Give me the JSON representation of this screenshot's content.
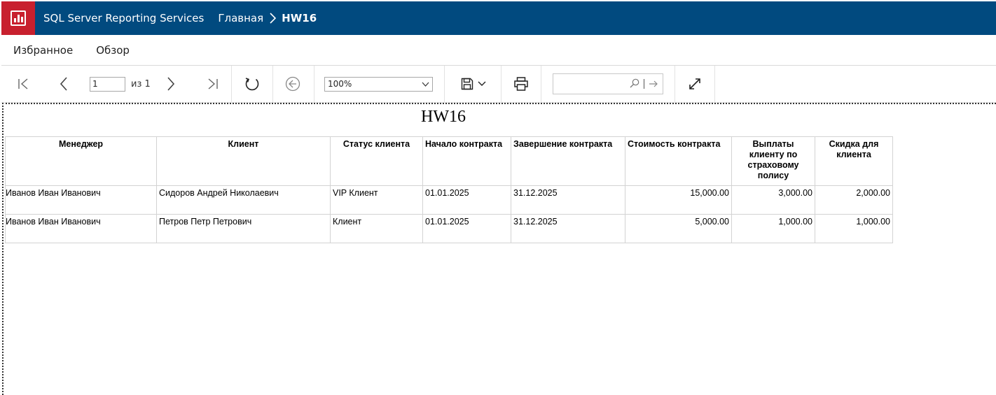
{
  "app": {
    "title": "SQL Server Reporting Services",
    "breadcrumb": {
      "home": "Главная",
      "current": "HW16"
    }
  },
  "nav": {
    "favorites": "Избранное",
    "browse": "Обзор"
  },
  "toolbar": {
    "page_value": "1",
    "page_total": "из 1",
    "zoom": "100%",
    "search_placeholder": ""
  },
  "report": {
    "title": "HW16",
    "columns": [
      "Менеджер",
      "Клиент",
      "Статус клиента",
      "Начало контракта",
      "Завершение контракта",
      "Стоимость контракта",
      "Выплаты клиенту по страховому полису",
      "Скидка для клиента"
    ],
    "rows": [
      [
        "Иванов Иван Иванович",
        "Сидоров Андрей Николаевич",
        "VIP Клиент",
        "01.01.2025",
        "31.12.2025",
        "15,000.00",
        "3,000.00",
        "2,000.00"
      ],
      [
        "Иванов Иван Иванович",
        "Петров Петр Петрович",
        "Клиент",
        "01.01.2025",
        "31.12.2025",
        "5,000.00",
        "1,000.00",
        "1,000.00"
      ]
    ]
  },
  "colors": {
    "appbar": "#014a7f",
    "logo": "#c8202e"
  }
}
